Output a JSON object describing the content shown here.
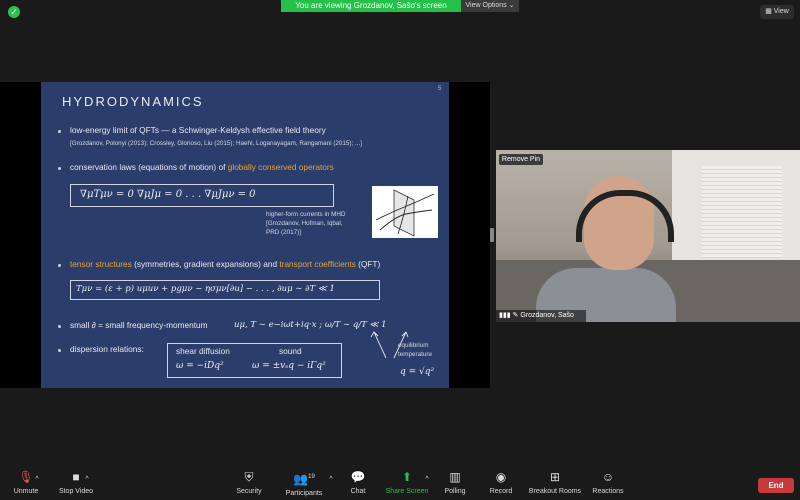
{
  "banner": {
    "viewing": "You are viewing Grozdanov, Sašo's screen",
    "view_options": "View Options",
    "view": "View"
  },
  "slide": {
    "title": "HYDRODYNAMICS",
    "page": "5",
    "b1": "low-energy limit of QFTs — a Schwinger-Keldysh effective field theory",
    "b1_refs": "[Grozdanov, Polonyi (2013); Crossley, Glorioso, Liu (2015); Haehl, Loganayagam, Rangamani (2015); ...]",
    "b2_pre": "conservation laws (equations of motion) of ",
    "b2_hl": "globally conserved operators",
    "eq1": "∇μTμν = 0     ∇μJμ = 0          . . . ∇μJμν = 0",
    "mhd1": "higher-form currents in MHD",
    "mhd2": "[Grozdanov, Hofman, Iqbal,",
    "mhd3": "PRD (2017)]",
    "b3_hl1": "tensor structures",
    "b3_mid": " (symmetries, gradient expansions) and ",
    "b3_hl2": "transport coefficients",
    "b3_end": " (QFT)",
    "eq2": "Tμν = (ε + p) uμuν + pgμν − ησμν[∂u] − . . . ,        ∂uμ ∼ ∂T ≪ 1",
    "b4": "small ∂ = small frequency-momentum",
    "b4_math": "uμ, T ∼ e−iωt+iq·x ;    ω/T ∼ q/T ≪ 1",
    "b5": "dispersion relations:",
    "shear": "shear diffusion",
    "sound": "sound",
    "shear_eq": "ω = −iDq²",
    "sound_eq": "ω = ±vₛq − iΓq²",
    "eq_label1": "equilibrium",
    "eq_label2": "temperature",
    "q_eq": "q = √q²"
  },
  "video": {
    "remove_pin": "Remove Pin",
    "name": "Grozdanov, Sašo"
  },
  "toolbar": {
    "unmute": "Unmute",
    "stop_video": "Stop Video",
    "security": "Security",
    "participants": "Participants",
    "participants_count": "19",
    "chat": "Chat",
    "share_screen": "Share Screen",
    "polling": "Polling",
    "record": "Record",
    "breakout": "Breakout Rooms",
    "reactions": "Reactions",
    "end": "End"
  },
  "colors": {
    "accent_green": "#24c04a",
    "slide_bg": "#2b3d6b",
    "highlight": "#e6a23a",
    "end_red": "#c83b3b"
  }
}
